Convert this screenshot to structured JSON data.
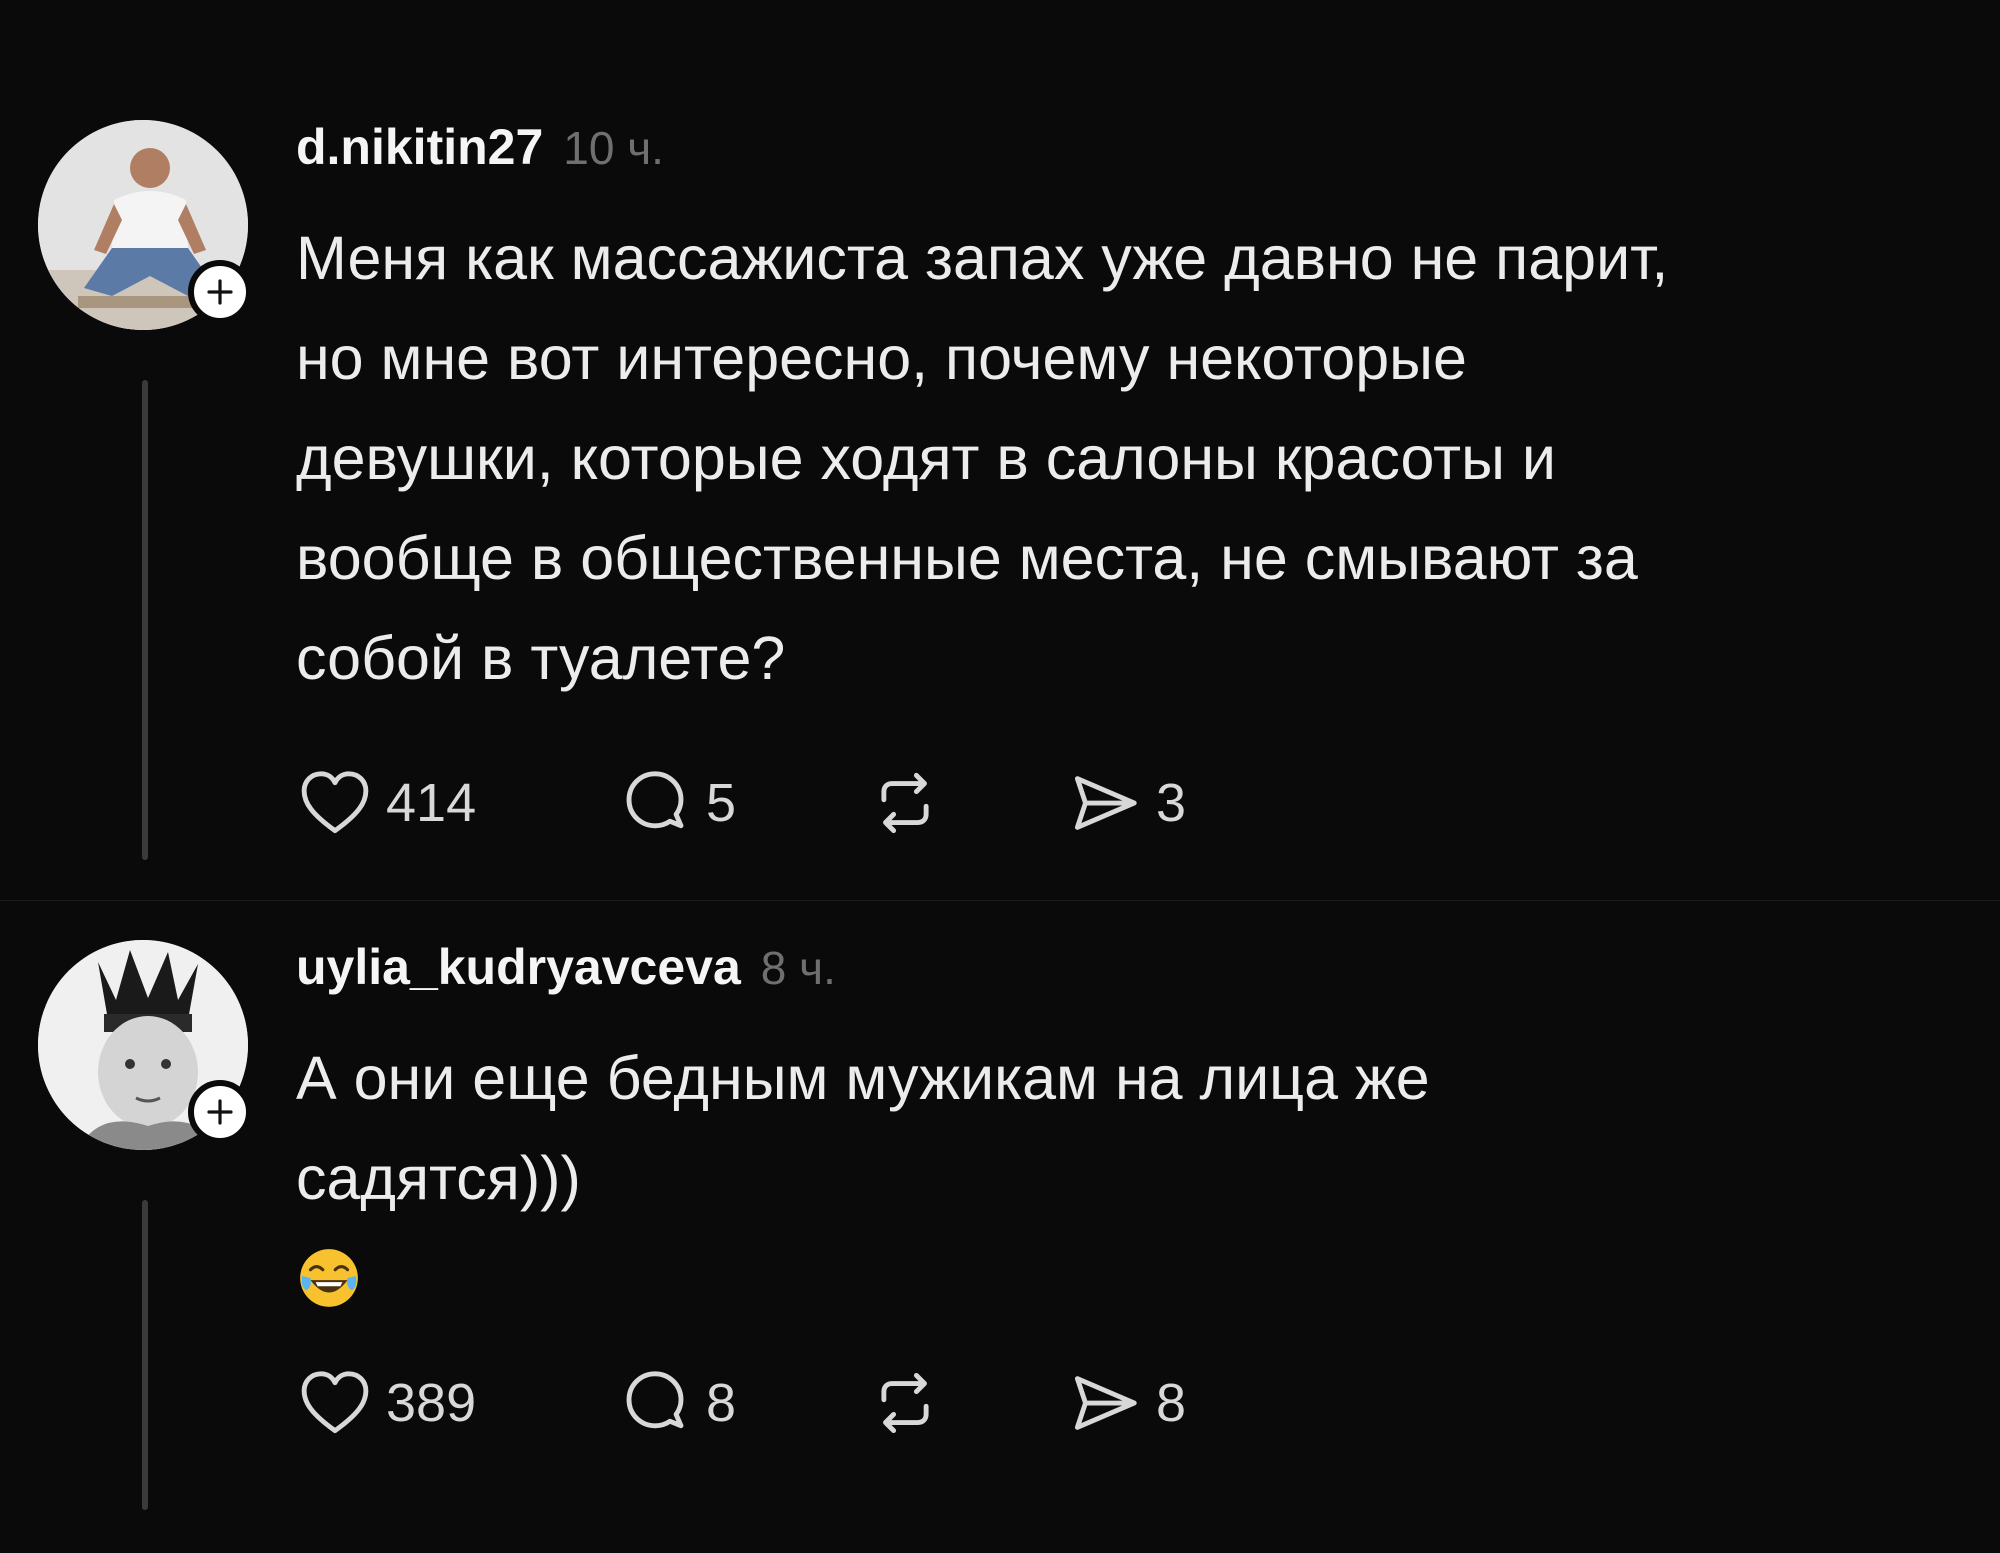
{
  "posts": [
    {
      "username": "d.nikitin27",
      "time": "10 ч.",
      "text": "Меня как массажиста запах уже давно не парит,\nно мне вот интересно, почему некоторые\nдевушки, которые ходят в салоны красоты и\nвообще в общественные места, не смывают за\nсобой в туалете?",
      "emoji": "",
      "likes": "414",
      "comments": "5",
      "shares": "3"
    },
    {
      "username": "uylia_kudryavceva",
      "time": "8 ч.",
      "text": "А они еще бедным мужикам на лица же\nсадятся)))",
      "emoji": "face-with-tears-of-joy",
      "likes": "389",
      "comments": "8",
      "shares": "8"
    }
  ],
  "colors": {
    "background": "#0b0a0b",
    "text": "#ececec",
    "muted": "#6f6f6f",
    "thread_line": "#3a3a3a"
  }
}
